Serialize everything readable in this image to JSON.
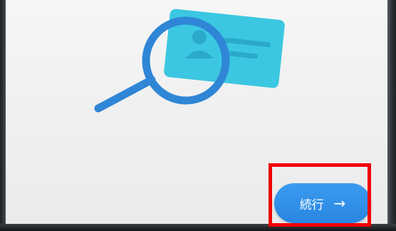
{
  "colors": {
    "card_fill": "#38c6e0",
    "magnifier_stroke": "#2f86d6",
    "button_fill": "#2f8ee6",
    "button_text": "#ffffff",
    "highlight_border": "#f20000",
    "screen_background": "#f3f3f3"
  },
  "illustration": {
    "icon_name": "id-card-search-icon"
  },
  "continue_button": {
    "label": "続行",
    "arrow_icon": "arrow-right-icon",
    "arrow_glyph": "→"
  }
}
